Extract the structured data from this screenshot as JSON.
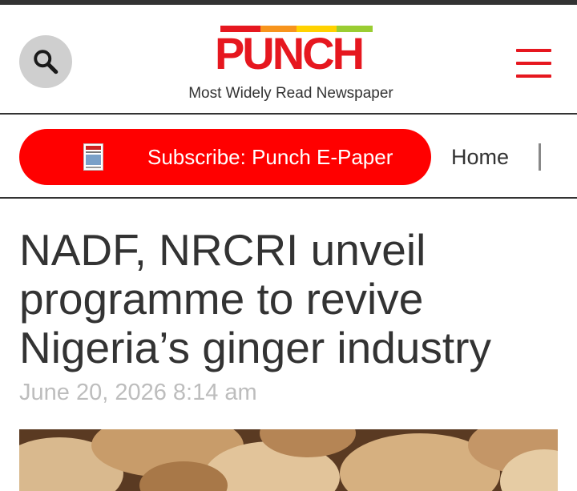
{
  "header": {
    "logo_text": "PUNCH",
    "tagline": "Most Widely Read Newspaper",
    "logo_color": "#e6171f",
    "logo_stripe_colors": [
      "#e6171f",
      "#f7941d",
      "#ffd200",
      "#9acd32"
    ],
    "search_icon": "search-icon",
    "menu_icon": "hamburger-menu-icon"
  },
  "nav": {
    "subscribe_label": "Subscribe: Punch E-Paper",
    "subscribe_color": "#ff0000",
    "home_label": "Home"
  },
  "article": {
    "headline": "NADF, NRCRI unveil programme to revive Nigeria’s ginger industry",
    "date": "June 20, 2026 8:14 am"
  }
}
